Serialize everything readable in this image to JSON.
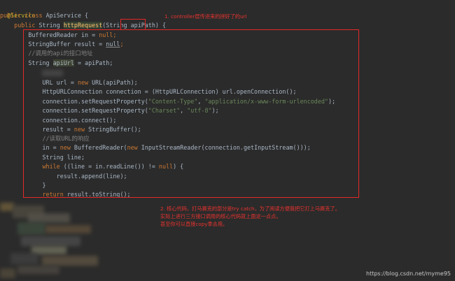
{
  "code": {
    "l0_annotation": "@Service",
    "l1_public": "public",
    "l1_class": "class",
    "l1_name": "ApiService {",
    "l2_public": "public",
    "l2_type": "String",
    "l2_method": "httpRequest",
    "l2_open": "(String ",
    "l2_param": "apiPath",
    "l2_close": ") {",
    "l3_text": "BufferedReader in = ",
    "l3_null": "null",
    "l3_end": ";",
    "l4_text": "StringBuffer result = ",
    "l4_null": "null",
    "l4_end": ";",
    "l5_comment": "//调用的api的接口地址",
    "l6_pre": "String ",
    "l6_var": "apiUrl",
    "l6_post": " = apiPath;",
    "l7_pre": "URL url = ",
    "l7_new": "new",
    "l7_post": " URL(apiPath);",
    "l8_text": "HttpURLConnection connection = (HttpURLConnection) url.openConnection();",
    "l9_pre": "connection.setRequestProperty(",
    "l9_s1": "\"Content-Type\"",
    "l9_mid": ", ",
    "l9_s2": "\"application/x-www-form-urlencoded\"",
    "l9_end": ");",
    "l10_pre": "connection.setRequestProperty(",
    "l10_s1": "\"Charset\"",
    "l10_mid": ", ",
    "l10_s2": "\"utf-8\"",
    "l10_end": ");",
    "l11_text": "connection.connect();",
    "l12_pre": "result = ",
    "l12_new": "new",
    "l12_post": " StringBuffer();",
    "l13_comment": "//读取URL的响应",
    "l14_pre": "in = ",
    "l14_new1": "new",
    "l14_mid": " BufferedReader(",
    "l14_new2": "new",
    "l14_post": " InputStreamReader(connection.getInputStream()));",
    "l15_text": "String line;",
    "l16_while": "while",
    "l16_mid": " ((line = in.readLine()) != ",
    "l16_null": "null",
    "l16_end": ") {",
    "l17_text": "result.append(line);",
    "l18_text": "}",
    "l19_return": "return",
    "l19_post": " result.toString();"
  },
  "notes": {
    "note1": "1. controller层传进来的拼好了的url",
    "note2_line1": "2. 核心代码，打马赛克的部分是try catch，为了阅读方便我把它打上马赛克了。",
    "note2_line2": "实际上进行三方接口调用的核心代码就上面这一点点。",
    "note2_line3": "甚至你可以直接copy拿去用。"
  },
  "watermark": "https://blog.csdn.net/myme95",
  "colors": {
    "editor_bg": "#2b2b2b",
    "keyword": "#cc7832",
    "string": "#6a8759",
    "annotation_text": "#e8332e",
    "highlight_box": "#e22828"
  }
}
